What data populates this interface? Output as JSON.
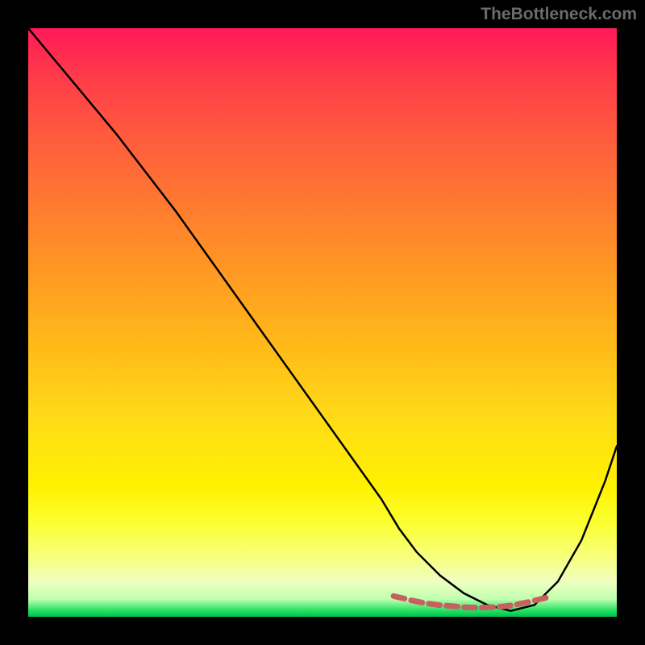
{
  "watermark": "TheBottleneck.com",
  "chart_data": {
    "type": "line",
    "title": "",
    "xlabel": "",
    "ylabel": "",
    "xlim": [
      0,
      100
    ],
    "ylim": [
      0,
      100
    ],
    "grid": false,
    "legend": false,
    "background_gradient": {
      "top_color": "#ff1a58",
      "bottom_color": "#00c050",
      "meaning": "higher on chart = worse bottleneck (red), lower = better match (green)"
    },
    "series": [
      {
        "name": "bottleneck_curve",
        "color": "#000000",
        "x": [
          0,
          5,
          10,
          15,
          20,
          25,
          30,
          35,
          40,
          45,
          50,
          55,
          60,
          63,
          66,
          70,
          74,
          78,
          82,
          86,
          90,
          94,
          98,
          100
        ],
        "y": [
          100,
          94,
          88,
          82,
          75.5,
          69,
          62,
          55,
          48,
          41,
          34,
          27,
          20,
          15,
          11,
          7,
          4,
          2,
          1,
          2,
          6,
          13,
          23,
          29
        ]
      },
      {
        "name": "optimal_zone_dotted",
        "style": "dotted",
        "color": "#c86060",
        "x": [
          63,
          66,
          69,
          72,
          75,
          78,
          81,
          84,
          87
        ],
        "y": [
          3.3,
          2.6,
          2.1,
          1.8,
          1.6,
          1.6,
          1.8,
          2.3,
          3.0
        ]
      }
    ],
    "optimal_x_range": [
      63,
      87
    ]
  }
}
